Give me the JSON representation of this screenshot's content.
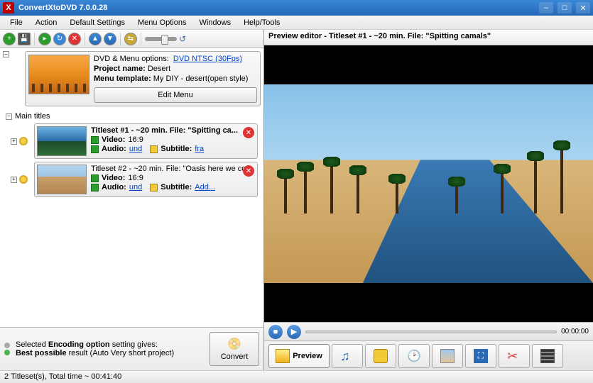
{
  "window": {
    "title": "ConvertXtoDVD 7.0.0.28",
    "icon": "X"
  },
  "menu": {
    "items": [
      "File",
      "Action",
      "Default Settings",
      "Menu Options",
      "Windows",
      "Help/Tools"
    ]
  },
  "dvd": {
    "line1_label": "DVD & Menu options:",
    "line1_link": "DVD NTSC (30Fps)",
    "line2_label": "Project name:",
    "line2_val": "Desert",
    "line3_label": "Menu template:",
    "line3_val": "My  DIY - desert(open style)",
    "edit_btn": "Edit Menu"
  },
  "tree": {
    "group": "Main titles",
    "titles": [
      {
        "header": "Titleset #1 - ~20 min. File: \"Spitting ca...",
        "video_label": "Video:",
        "video_val": "16:9",
        "audio_label": "Audio:",
        "audio_link": "und",
        "sub_label": "Subtitle:",
        "sub_link": "fra"
      },
      {
        "header": "Titleset #2 - ~20 min. File: \"Oasis here we co...",
        "video_label": "Video:",
        "video_val": "16:9",
        "audio_label": "Audio:",
        "audio_link": "und",
        "sub_label": "Subtitle:",
        "sub_link": "Add..."
      }
    ]
  },
  "encoding": {
    "line1a": "Selected ",
    "line1b": "Encoding option",
    "line1c": " setting gives:",
    "line2a": "Best possible",
    "line2b": " result (Auto Very short project)"
  },
  "convert_btn": "Convert",
  "preview": {
    "title": "Preview editor - Titleset #1 - ~20 min. File: \"Spitting camals\"",
    "time": "00:00:00"
  },
  "tabs": {
    "active_label": "Preview"
  },
  "status": "2 Titleset(s), Total time ~ 00:41:40"
}
